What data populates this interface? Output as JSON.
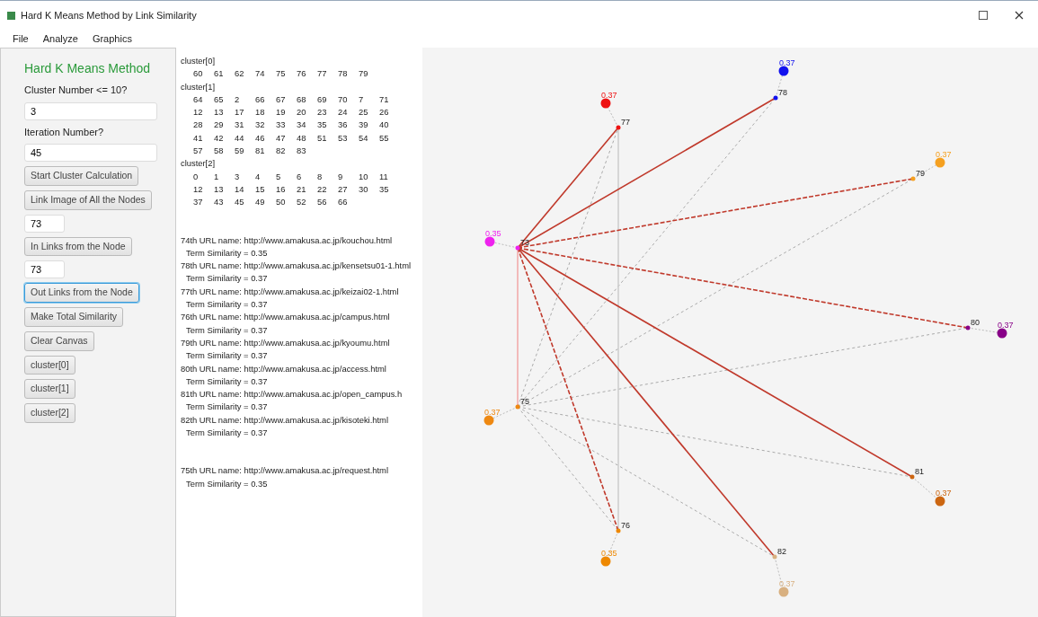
{
  "window": {
    "title": "Hard K Means Method by Link Similarity"
  },
  "menu": [
    "File",
    "Analyze",
    "Graphics"
  ],
  "panel": [
    {
      "kind": "heading",
      "text": "Hard K Means Method"
    },
    {
      "kind": "label",
      "text": "Cluster Number <= 10?"
    },
    {
      "kind": "input",
      "value": "3"
    },
    {
      "kind": "label",
      "text": "Iteration Number?"
    },
    {
      "kind": "input",
      "value": "45"
    },
    {
      "kind": "button",
      "text": "Start Cluster Calculation",
      "focused": false
    },
    {
      "kind": "button",
      "text": "Link Image of All the Nodes",
      "focused": false
    },
    {
      "kind": "shortinput",
      "value": "73"
    },
    {
      "kind": "button",
      "text": "In Links from the Node",
      "focused": false
    },
    {
      "kind": "shortinput",
      "value": "73"
    },
    {
      "kind": "button",
      "text": "Out Links from the Node",
      "focused": true
    },
    {
      "kind": "button",
      "text": "Make Total Similarity",
      "focused": false
    },
    {
      "kind": "button",
      "text": "Clear Canvas",
      "focused": false
    },
    {
      "kind": "button",
      "text": "cluster[0]",
      "focused": false
    },
    {
      "kind": "button",
      "text": "cluster[1]",
      "focused": false
    },
    {
      "kind": "button",
      "text": "cluster[2]",
      "focused": false
    }
  ],
  "clusters": [
    {
      "name": "cluster[0]",
      "rows": [
        [
          "60",
          "61",
          "62",
          "74",
          "75",
          "76",
          "77",
          "78",
          "79"
        ]
      ]
    },
    {
      "name": "cluster[1]",
      "rows": [
        [
          "64",
          "65",
          "2",
          "66",
          "67",
          "68",
          "69",
          "70",
          "7",
          "71"
        ],
        [
          "12",
          "13",
          "17",
          "18",
          "19",
          "20",
          "23",
          "24",
          "25",
          "26"
        ],
        [
          "28",
          "29",
          "31",
          "32",
          "33",
          "34",
          "35",
          "36",
          "39",
          "40"
        ],
        [
          "41",
          "42",
          "44",
          "46",
          "47",
          "48",
          "51",
          "53",
          "54",
          "55"
        ],
        [
          "57",
          "58",
          "59",
          "81",
          "82",
          "83"
        ]
      ]
    },
    {
      "name": "cluster[2]",
      "rows": [
        [
          "0",
          "1",
          "3",
          "4",
          "5",
          "6",
          "8",
          "9",
          "10",
          "11"
        ],
        [
          "12",
          "13",
          "14",
          "15",
          "16",
          "21",
          "22",
          "27",
          "30",
          "35"
        ],
        [
          "37",
          "43",
          "45",
          "49",
          "50",
          "52",
          "56",
          "66"
        ]
      ]
    }
  ],
  "results": [
    {
      "url": "74th URL name: http://www.amakusa.ac.jp/kouchou.html",
      "similarity": "Term Similarity = 0.35"
    },
    {
      "url": "78th URL name: http://www.amakusa.ac.jp/kensetsu01-1.html",
      "similarity": "Term Similarity = 0.37"
    },
    {
      "url": "77th URL name: http://www.amakusa.ac.jp/keizai02-1.html",
      "similarity": "Term Similarity = 0.37"
    },
    {
      "url": "76th URL name: http://www.amakusa.ac.jp/campus.html",
      "similarity": "Term Similarity = 0.37"
    },
    {
      "url": "79th URL name: http://www.amakusa.ac.jp/kyoumu.html",
      "similarity": "Term Similarity = 0.37"
    },
    {
      "url": "80th URL name: http://www.amakusa.ac.jp/access.html",
      "similarity": "Term Similarity = 0.37"
    },
    {
      "url": "81th URL name: http://www.amakusa.ac.jp/open_campus.h",
      "similarity": "Term Similarity = 0.37"
    },
    {
      "url": "82th URL name: http://www.amakusa.ac.jp/kisoteki.html",
      "similarity": "Term Similarity = 0.37"
    },
    {
      "url": "75th URL name: http://www.amakusa.ac.jp/request.html",
      "similarity": "Term Similarity = 0.35",
      "separated": true
    }
  ],
  "graph": {
    "hub": {
      "label": "73",
      "score": "0.35",
      "color": "#ee22ee"
    },
    "nodes": [
      {
        "label": "77",
        "score": "0.37",
        "color": "#ee1111",
        "kind": "solid"
      },
      {
        "label": "78",
        "score": "0.37",
        "color": "#1111ee",
        "kind": "solid"
      },
      {
        "label": "79",
        "score": "0.37",
        "color": "#f5a020",
        "kind": "dashed"
      },
      {
        "label": "80",
        "score": "0.37",
        "color": "#880088",
        "kind": "dashed"
      },
      {
        "label": "81",
        "score": "0.37",
        "color": "#cc6611",
        "kind": "solid"
      },
      {
        "label": "82",
        "score": "0.37",
        "color": "#d8b080",
        "kind": "solid"
      },
      {
        "label": "76",
        "score": "0.35",
        "color": "#ee8800",
        "kind": "dashed"
      },
      {
        "label": "75",
        "score": "0.37",
        "color": "#ee8811",
        "kind": "thin"
      }
    ]
  }
}
